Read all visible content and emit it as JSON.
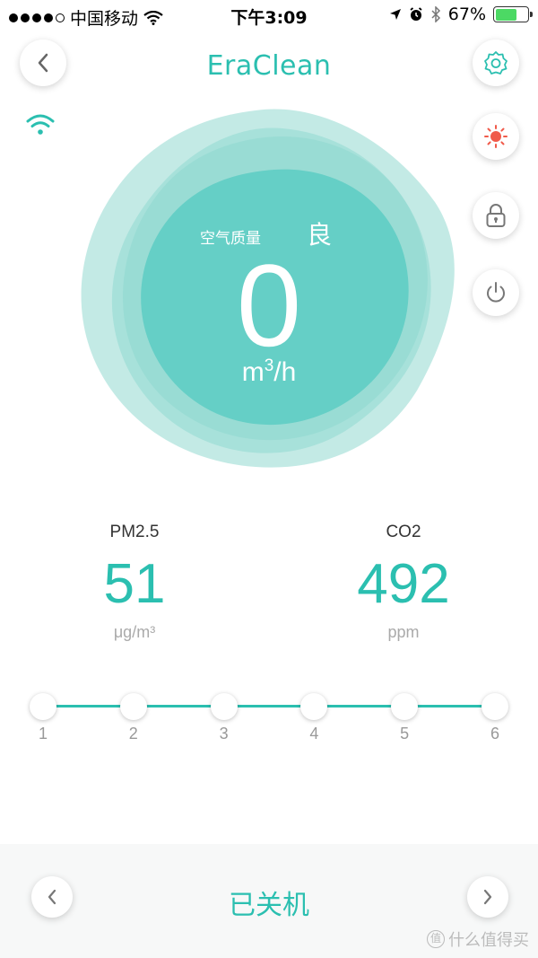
{
  "status_bar": {
    "carrier": "中国移动",
    "time": "下午3:09",
    "battery": "67%",
    "battery_level": 0.67,
    "signal_bars": 4
  },
  "header": {
    "logo": "EraClean",
    "back_icon": "chevron-left-icon",
    "settings_icon": "gear-icon"
  },
  "side_controls": [
    {
      "name": "light",
      "icon": "sun-icon"
    },
    {
      "name": "lock",
      "icon": "lock-icon"
    },
    {
      "name": "power",
      "icon": "power-icon"
    }
  ],
  "air": {
    "label": "空气质量",
    "grade": "良",
    "value": "0",
    "unit_base": "m",
    "unit_sup": "3",
    "unit_tail": "/h"
  },
  "readings": {
    "pm25": {
      "label": "PM2.5",
      "value": "51",
      "unit": "μg/m³"
    },
    "co2": {
      "label": "CO2",
      "value": "492",
      "unit": "ppm"
    }
  },
  "speed": {
    "levels": [
      "1",
      "2",
      "3",
      "4",
      "5",
      "6"
    ]
  },
  "bottom": {
    "status": "已关机"
  },
  "watermark": {
    "badge": "值",
    "text": "什么值得买"
  },
  "colors": {
    "accent": "#2bbfb0",
    "blob_light": "#b8e6e1",
    "blob_mid": "#8fd8d1",
    "blob_core": "#5fcdc4",
    "light_icon": "#f05a4a"
  }
}
